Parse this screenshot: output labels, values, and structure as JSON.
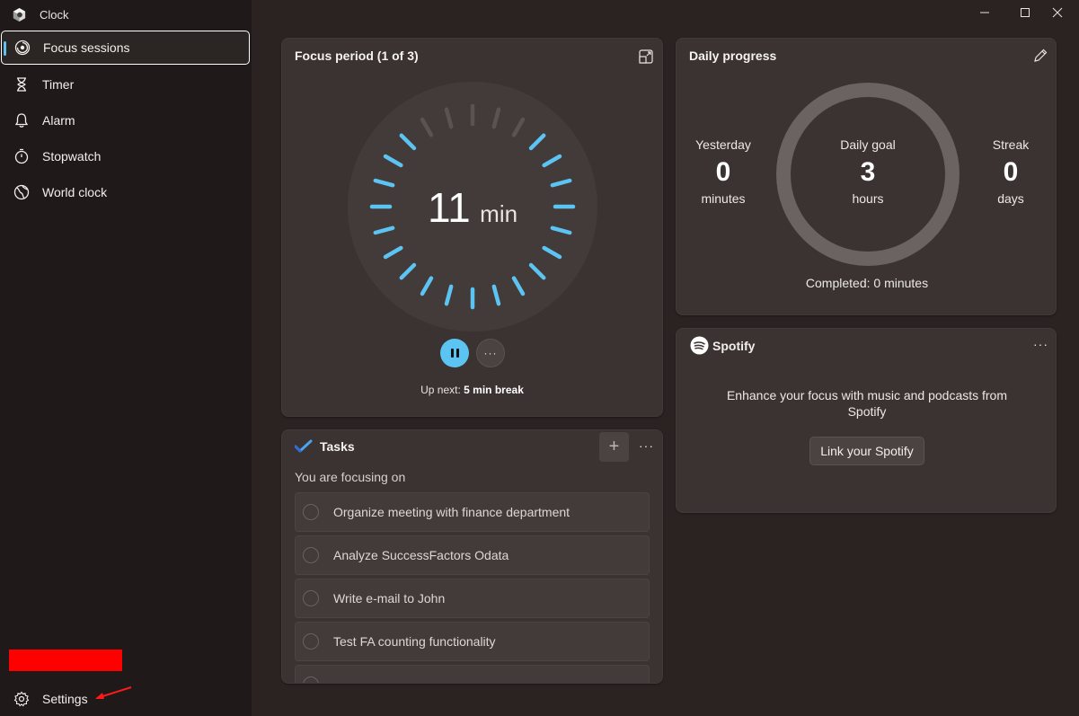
{
  "app": {
    "title": "Clock"
  },
  "sidebar": {
    "items": [
      {
        "label": "Focus sessions",
        "icon": "focus-icon",
        "active": true
      },
      {
        "label": "Timer",
        "icon": "hourglass-icon"
      },
      {
        "label": "Alarm",
        "icon": "bell-icon"
      },
      {
        "label": "Stopwatch",
        "icon": "stopwatch-icon"
      },
      {
        "label": "World clock",
        "icon": "globe-icon"
      }
    ],
    "settings_label": "Settings"
  },
  "focus": {
    "title": "Focus period (1 of 3)",
    "minutes": "11",
    "unit": "min",
    "upnext_prefix": "Up next:",
    "upnext_value": "5 min break",
    "more": "···"
  },
  "daily": {
    "title": "Daily progress",
    "yesterday": {
      "label": "Yesterday",
      "value": "0",
      "unit": "minutes"
    },
    "goal": {
      "label": "Daily goal",
      "value": "3",
      "unit": "hours"
    },
    "streak": {
      "label": "Streak",
      "value": "0",
      "unit": "days"
    },
    "completed": "Completed: 0 minutes"
  },
  "spotify": {
    "name": "Spotify",
    "message": "Enhance your focus with music and podcasts from Spotify",
    "link_label": "Link your Spotify",
    "more": "···"
  },
  "tasks": {
    "title": "Tasks",
    "add": "+",
    "more": "···",
    "subtitle": "You are focusing on",
    "items": [
      "Organize meeting with finance department",
      "Analyze SuccessFactors Odata",
      "Write e-mail to John",
      "Test FA counting functionality"
    ]
  },
  "colors": {
    "accent": "#5cc4f3",
    "card": "#3a3331",
    "redaction": "#ff0000"
  }
}
